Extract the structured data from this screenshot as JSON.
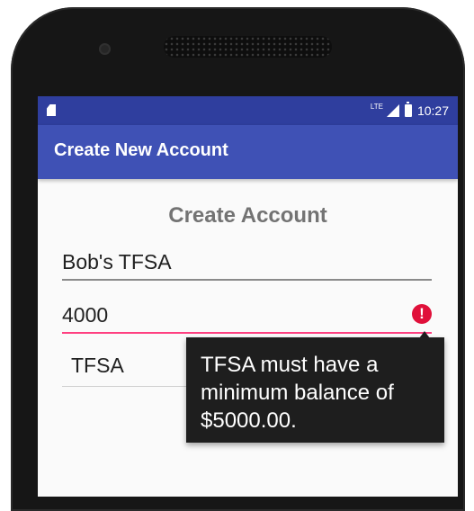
{
  "status_bar": {
    "network_label": "LTE",
    "time": "10:27"
  },
  "app_bar": {
    "title": "Create New Account"
  },
  "form": {
    "heading": "Create Account",
    "account_name": "Bob's TFSA",
    "balance": "4000",
    "account_type": "TFSA",
    "error_icon_glyph": "!",
    "error_message": "TFSA must have a minimum balance of $5000.00."
  },
  "colors": {
    "status_bar": "#2f3e9e",
    "app_bar": "#3f51b5",
    "error_accent": "#ff4081",
    "error_icon": "#e0103a"
  },
  "icons": [
    "sd-card-icon",
    "signal-icon",
    "battery-icon",
    "error-icon",
    "dropdown-arrow-icon"
  ]
}
